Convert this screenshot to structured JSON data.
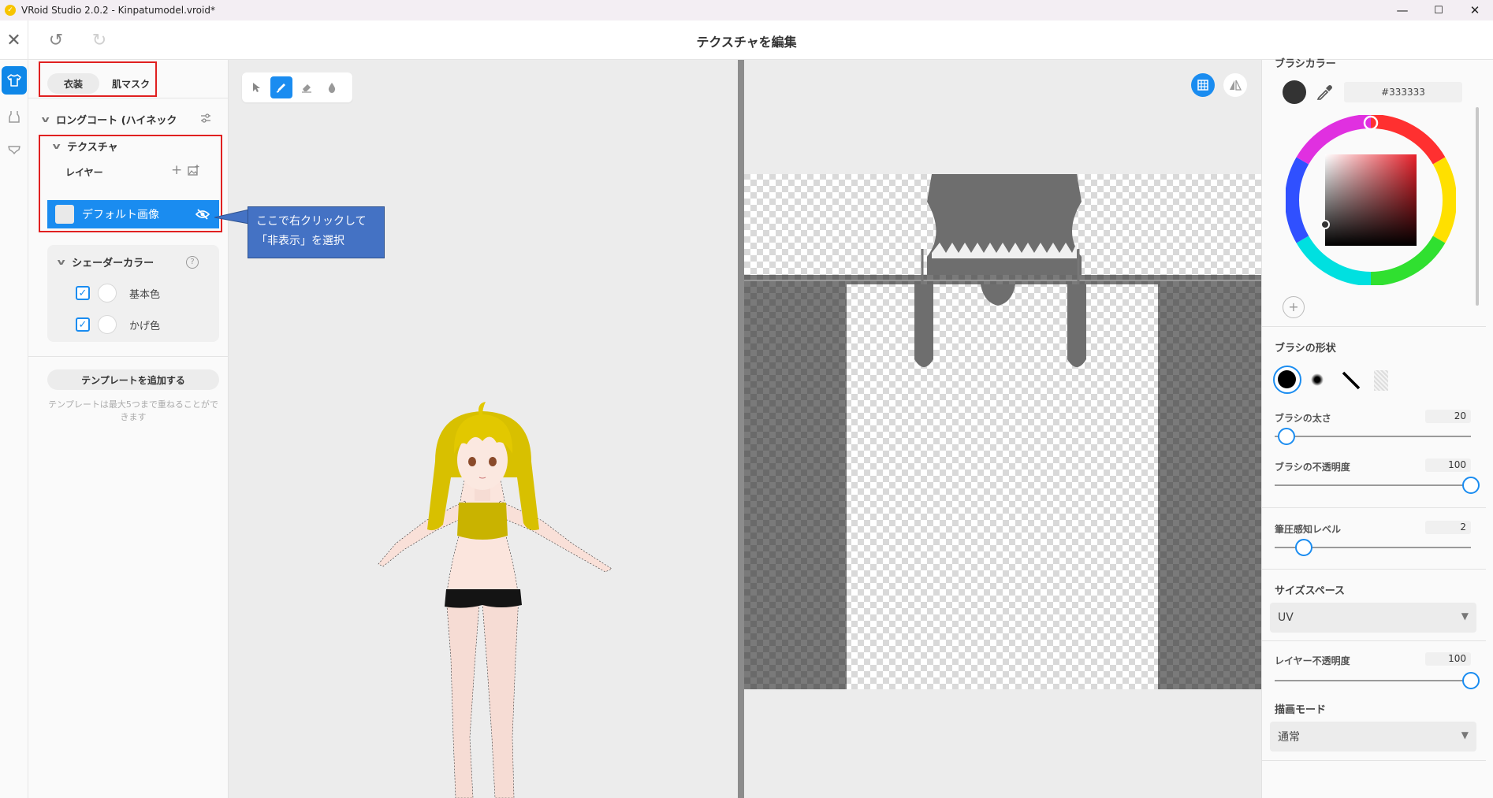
{
  "window": {
    "title": "VRoid Studio 2.0.2 - Kinpatumodel.vroid*",
    "minimize": "—",
    "maximize": "☐",
    "close": "✕"
  },
  "header": {
    "title": "テクスチャを編集",
    "close_glyph": "✕",
    "undo_glyph": "↺",
    "redo_glyph": "↻"
  },
  "left_panel": {
    "tabs": [
      "衣装",
      "肌マスク"
    ],
    "item_title": "ロングコート (ハイネック",
    "texture_section": "テクスチャ",
    "layer_label": "レイヤー",
    "layer_add_glyph": "+",
    "selected_layer": "デフォルト画像",
    "shader_section": "シェーダーカラー",
    "shader_help_glyph": "?",
    "shader_colors": [
      "基本色",
      "かげ色"
    ],
    "template_button": "テンプレートを追加する",
    "template_note": "テンプレートは最大5つまで重ねることができます"
  },
  "callout": {
    "line1": "ここで右クリックして",
    "line2": "「非表示」を選択"
  },
  "right_panel": {
    "brush_color_label": "ブラシカラー",
    "brush_color_hex": "#333333",
    "add_glyph": "+",
    "brush_shape_label": "ブラシの形状",
    "brush_size_label": "ブラシの太さ",
    "brush_size_value": "20",
    "brush_opacity_label": "ブラシの不透明度",
    "brush_opacity_value": "100",
    "pressure_label": "筆圧感知レベル",
    "pressure_value": "2",
    "size_space_label": "サイズスペース",
    "size_space_value": "UV",
    "layer_opacity_label": "レイヤー不透明度",
    "layer_opacity_value": "100",
    "draw_mode_label": "描画モード",
    "draw_mode_value": "通常"
  },
  "sliders": {
    "brush_size_fraction": 0.06,
    "brush_opacity_fraction": 1.0,
    "pressure_fraction": 0.15,
    "layer_opacity_fraction": 1.0
  },
  "icons": {
    "rail": [
      "shirt-icon",
      "top-icon",
      "underwear-icon"
    ],
    "tools": [
      "cursor-icon",
      "brush-icon",
      "eraser-icon",
      "fill-icon"
    ],
    "texture_view": [
      "grid-icon",
      "mirror-icon"
    ]
  },
  "colors": {
    "accent": "#1a8cf0",
    "highlight_box": "#e02020",
    "callout": "#4472c4",
    "brush": "#333333"
  }
}
